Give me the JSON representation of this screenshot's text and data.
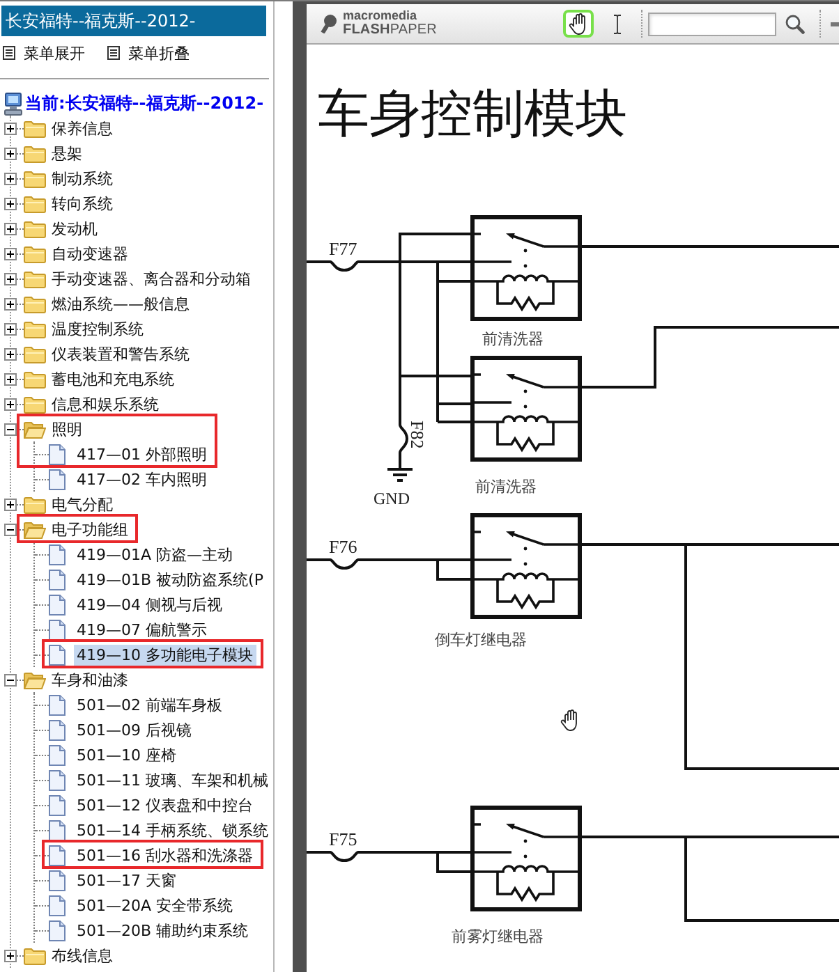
{
  "sidebar": {
    "title": "长安福特--福克斯--2012-",
    "menu_actions": [
      {
        "label": "菜单展开"
      },
      {
        "label": "菜单折叠"
      }
    ],
    "tree": {
      "root": {
        "label": "当前:长安福特--福克斯--2012-"
      },
      "items": [
        {
          "label": "保养信息",
          "kind": "folder",
          "expanded": false,
          "selected": false,
          "marked": false
        },
        {
          "label": "悬架",
          "kind": "folder",
          "expanded": false,
          "selected": false,
          "marked": false
        },
        {
          "label": "制动系统",
          "kind": "folder",
          "expanded": false,
          "selected": false,
          "marked": false
        },
        {
          "label": "转向系统",
          "kind": "folder",
          "expanded": false,
          "selected": false,
          "marked": false
        },
        {
          "label": "发动机",
          "kind": "folder",
          "expanded": false,
          "selected": false,
          "marked": false
        },
        {
          "label": "自动变速器",
          "kind": "folder",
          "expanded": false,
          "selected": false,
          "marked": false
        },
        {
          "label": "手动变速器、离合器和分动箱",
          "kind": "folder",
          "expanded": false,
          "selected": false,
          "marked": false
        },
        {
          "label": "燃油系统——般信息",
          "kind": "folder",
          "expanded": false,
          "selected": false,
          "marked": false
        },
        {
          "label": "温度控制系统",
          "kind": "folder",
          "expanded": false,
          "selected": false,
          "marked": false
        },
        {
          "label": "仪表装置和警告系统",
          "kind": "folder",
          "expanded": false,
          "selected": false,
          "marked": false
        },
        {
          "label": "蓄电池和充电系统",
          "kind": "folder",
          "expanded": false,
          "selected": false,
          "marked": false
        },
        {
          "label": "信息和娱乐系统",
          "kind": "folder",
          "expanded": false,
          "selected": false,
          "marked": false
        },
        {
          "label": "照明",
          "kind": "folder",
          "expanded": true,
          "selected": false,
          "marked": true,
          "children": [
            {
              "label": "417—01 外部照明",
              "kind": "page",
              "selected": false,
              "marked": true
            },
            {
              "label": "417—02 车内照明",
              "kind": "page",
              "selected": false,
              "marked": false
            }
          ]
        },
        {
          "label": "电气分配",
          "kind": "folder",
          "expanded": false,
          "selected": false,
          "marked": false
        },
        {
          "label": "电子功能组",
          "kind": "folder",
          "expanded": true,
          "selected": false,
          "marked": true,
          "children": [
            {
              "label": "419—01A 防盗—主动",
              "kind": "page",
              "selected": false,
              "marked": false
            },
            {
              "label": "419—01B 被动防盗系统(P",
              "kind": "page",
              "selected": false,
              "marked": false
            },
            {
              "label": "419—04 侧视与后视",
              "kind": "page",
              "selected": false,
              "marked": false
            },
            {
              "label": "419—07 偏航警示",
              "kind": "page",
              "selected": false,
              "marked": false
            },
            {
              "label": "419—10 多功能电子模块",
              "kind": "page",
              "selected": true,
              "marked": true
            }
          ]
        },
        {
          "label": "车身和油漆",
          "kind": "folder",
          "expanded": true,
          "selected": false,
          "marked": false,
          "children": [
            {
              "label": "501—02 前端车身板",
              "kind": "page",
              "selected": false,
              "marked": false
            },
            {
              "label": "501—09 后视镜",
              "kind": "page",
              "selected": false,
              "marked": false
            },
            {
              "label": "501—10 座椅",
              "kind": "page",
              "selected": false,
              "marked": false
            },
            {
              "label": "501—11 玻璃、车架和机械",
              "kind": "page",
              "selected": false,
              "marked": false
            },
            {
              "label": "501—12 仪表盘和中控台",
              "kind": "page",
              "selected": false,
              "marked": false
            },
            {
              "label": "501—14 手柄系统、锁系统",
              "kind": "page",
              "selected": false,
              "marked": false
            },
            {
              "label": "501—16 刮水器和洗涤器",
              "kind": "page",
              "selected": false,
              "marked": true
            },
            {
              "label": "501—17 天窗",
              "kind": "page",
              "selected": false,
              "marked": false
            },
            {
              "label": "501—20A 安全带系统",
              "kind": "page",
              "selected": false,
              "marked": false
            },
            {
              "label": "501—20B 辅助约束系统",
              "kind": "page",
              "selected": false,
              "marked": false
            }
          ]
        },
        {
          "label": "布线信息",
          "kind": "folder",
          "expanded": false,
          "selected": false,
          "marked": false
        }
      ]
    }
  },
  "viewer": {
    "brand": {
      "company": "macromedia",
      "product": "**FLASH**PAPER"
    },
    "tools": [
      {
        "kind": "hand",
        "selected": true
      },
      {
        "kind": "text",
        "selected": false
      }
    ]
  },
  "document": {
    "title": "车身控制模块",
    "diagram": {
      "fuses": [
        {
          "label": "F77"
        },
        {
          "label": "F82"
        },
        {
          "label": "F76"
        },
        {
          "label": "F75"
        }
      ],
      "ground": {
        "label": "GND"
      },
      "relays": [
        {
          "label": "前清洗器"
        },
        {
          "label": "前清洗器"
        },
        {
          "label": "倒车灯继电器"
        },
        {
          "label": "前雾灯继电器"
        }
      ]
    }
  }
}
